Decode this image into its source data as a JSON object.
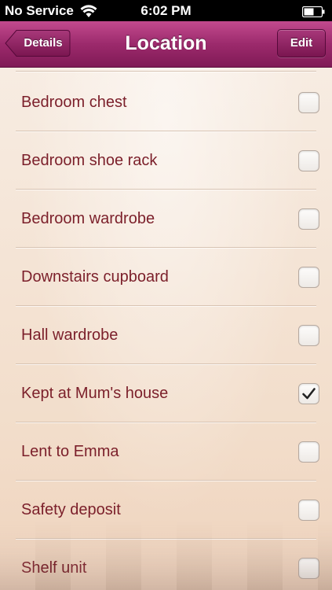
{
  "status_bar": {
    "carrier": "No Service",
    "time": "6:02 PM",
    "wifi_icon": "wifi-icon",
    "battery_icon": "battery-icon"
  },
  "nav": {
    "title": "Location",
    "back_label": "Details",
    "edit_label": "Edit",
    "accent": "#9c2a6c"
  },
  "locations": [
    {
      "label": "Bedroom chest",
      "checked": false
    },
    {
      "label": "Bedroom shoe rack",
      "checked": false
    },
    {
      "label": "Bedroom wardrobe",
      "checked": false
    },
    {
      "label": "Downstairs cupboard",
      "checked": false
    },
    {
      "label": "Hall wardrobe",
      "checked": false
    },
    {
      "label": "Kept at Mum's house",
      "checked": true
    },
    {
      "label": "Lent to Emma",
      "checked": false
    },
    {
      "label": "Safety deposit",
      "checked": false
    },
    {
      "label": "Shelf unit",
      "checked": false
    }
  ],
  "colors": {
    "label_text": "#7b1f2a",
    "checkmark": "#222222"
  }
}
